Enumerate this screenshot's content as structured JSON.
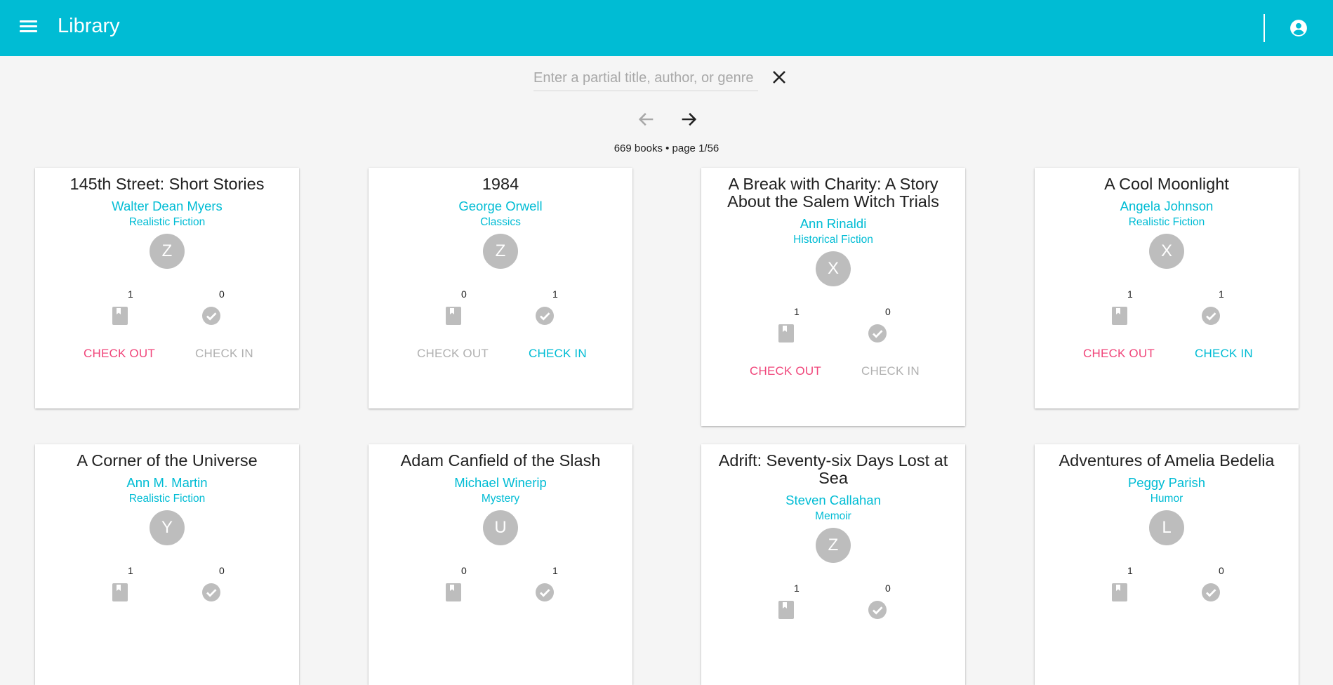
{
  "app": {
    "title": "Library"
  },
  "icons": {
    "menu": "menu-icon",
    "account": "account-circle-icon",
    "clear": "close-icon",
    "prev": "arrow-left-icon",
    "next": "arrow-right-icon",
    "checked_out": "book-icon",
    "available": "check-circle-icon"
  },
  "colors": {
    "primary": "#00bcd4",
    "accent": "#f0457a",
    "disabled": "#b0b0b0",
    "avatar": "#bdbdbd"
  },
  "search": {
    "placeholder": "Enter a partial title, author, or genre",
    "value": ""
  },
  "pagination": {
    "status": "669 books • page 1/56",
    "prev_enabled": false,
    "next_enabled": true
  },
  "labels": {
    "check_out": "CHECK OUT",
    "check_in": "CHECK IN"
  },
  "books": [
    {
      "title": "145th Street: Short Stories",
      "author": "Walter Dean Myers",
      "genre": "Realistic Fiction",
      "avatar": "Z",
      "checked_out": "1",
      "available": "0",
      "check_out_enabled": true,
      "check_in_enabled": false
    },
    {
      "title": "1984",
      "author": "George Orwell",
      "genre": "Classics",
      "avatar": "Z",
      "checked_out": "0",
      "available": "1",
      "check_out_enabled": false,
      "check_in_enabled": true
    },
    {
      "title": "A Break with Charity: A Story About the Salem Witch Trials",
      "author": "Ann Rinaldi",
      "genre": "Historical Fiction",
      "avatar": "X",
      "checked_out": "1",
      "available": "0",
      "check_out_enabled": true,
      "check_in_enabled": false
    },
    {
      "title": "A Cool Moonlight",
      "author": "Angela Johnson",
      "genre": "Realistic Fiction",
      "avatar": "X",
      "checked_out": "1",
      "available": "1",
      "check_out_enabled": true,
      "check_in_enabled": true
    },
    {
      "title": "A Corner of the Universe",
      "author": "Ann M. Martin",
      "genre": "Realistic Fiction",
      "avatar": "Y",
      "checked_out": "1",
      "available": "0"
    },
    {
      "title": "Adam Canfield of the Slash",
      "author": "Michael Winerip",
      "genre": "Mystery",
      "avatar": "U",
      "checked_out": "0",
      "available": "1"
    },
    {
      "title": "Adrift: Seventy-six Days Lost at Sea",
      "author": "Steven Callahan",
      "genre": "Memoir",
      "avatar": "Z",
      "checked_out": "1",
      "available": "0"
    },
    {
      "title": "Adventures of Amelia Bedelia",
      "author": "Peggy Parish",
      "genre": "Humor",
      "avatar": "L",
      "checked_out": "1",
      "available": "0"
    }
  ]
}
